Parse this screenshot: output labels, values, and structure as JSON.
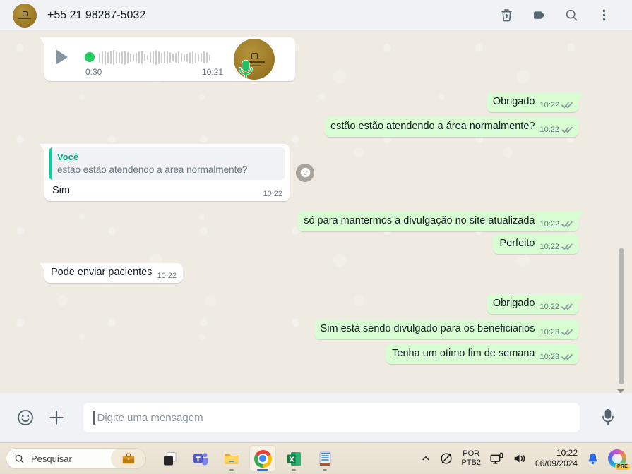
{
  "header": {
    "title": "+55 21 98287-5032"
  },
  "voice_message": {
    "duration": "0:30",
    "time": "10:21",
    "waveform": [
      14,
      18,
      20,
      16,
      19,
      21,
      17,
      15,
      18,
      20,
      16,
      12,
      9,
      13,
      17,
      19,
      11,
      7,
      15,
      19,
      21,
      18,
      14,
      17,
      19,
      15,
      11,
      14,
      17,
      13,
      9,
      12,
      16,
      18,
      14,
      10,
      13,
      17,
      15,
      8
    ]
  },
  "messages": [
    {
      "direction": "out",
      "text": "Obrigado",
      "time": "10:22",
      "status": "delivered"
    },
    {
      "direction": "out",
      "text": "estão estão atendendo a área normalmente?",
      "time": "10:22",
      "status": "delivered"
    },
    {
      "direction": "in",
      "quote_author": "Você",
      "quote_text": "estão estão atendendo a área normalmente?",
      "text": "Sim",
      "time": "10:22"
    },
    {
      "direction": "out",
      "text": "só para mantermos a divulgação no site atualizada",
      "time": "10:22",
      "status": "delivered"
    },
    {
      "direction": "out",
      "text": "Perfeito",
      "time": "10:22",
      "status": "delivered"
    },
    {
      "direction": "in",
      "text": "Pode enviar pacientes",
      "time": "10:22"
    },
    {
      "direction": "out",
      "text": "Obrigado",
      "time": "10:22",
      "status": "delivered"
    },
    {
      "direction": "out",
      "text": "Sim está sendo divulgado para os beneficiarios",
      "time": "10:23",
      "status": "delivered"
    },
    {
      "direction": "out",
      "text": "Tenha um otimo fim de semana",
      "time": "10:23",
      "status": "delivered"
    }
  ],
  "composer": {
    "placeholder": "Digite uma mensagem"
  },
  "taskbar": {
    "search_placeholder": "Pesquisar",
    "tray": {
      "language": "POR",
      "layout": "PTB2",
      "time": "10:22",
      "date": "06/09/2024",
      "copilot_badge": "PRE"
    }
  },
  "colors": {
    "outgoing_bubble": "#d9fdd3",
    "accent_green": "#06cf9c",
    "check_gray": "#8696a0",
    "bell_blue": "#2668e3"
  }
}
